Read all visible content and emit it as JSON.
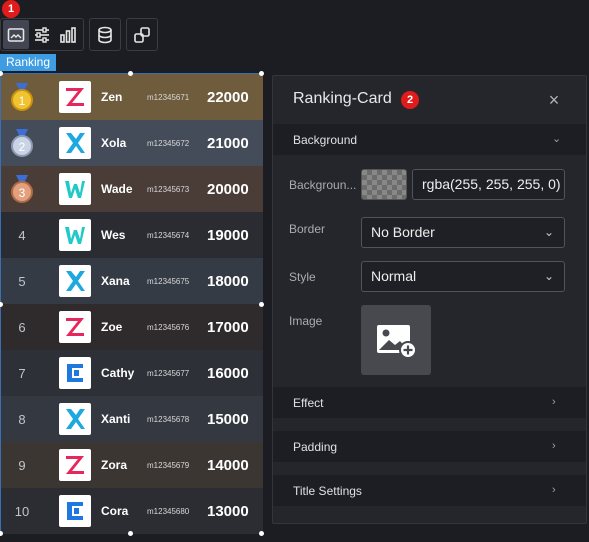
{
  "toolbar": {
    "badge": "1",
    "buttons": [
      {
        "icon": "image-icon",
        "active": true
      },
      {
        "icon": "sliders-icon",
        "active": false
      },
      {
        "icon": "bar-chart-icon",
        "active": false
      },
      {
        "icon": "database-icon",
        "active": false
      },
      {
        "icon": "interaction-icon",
        "active": false
      }
    ]
  },
  "component_tag": "Ranking",
  "ranking": [
    {
      "rank": "1",
      "name": "Zen",
      "id": "m12345671",
      "score": "22000",
      "logo": "Z",
      "color": "#e8265e",
      "bg": "#6e5c3d",
      "medal": "gold"
    },
    {
      "rank": "2",
      "name": "Xola",
      "id": "m12345672",
      "score": "21000",
      "logo": "X",
      "color": "#1da8e0",
      "bg": "#444c5a",
      "medal": "silver"
    },
    {
      "rank": "3",
      "name": "Wade",
      "id": "m12345673",
      "score": "20000",
      "logo": "W",
      "color": "#23c9c9",
      "bg": "#4a3d37",
      "medal": "bronze"
    },
    {
      "rank": "4",
      "name": "Wes",
      "id": "m12345674",
      "score": "19000",
      "logo": "W",
      "color": "#23c9c9",
      "bg": "#2b2c31"
    },
    {
      "rank": "5",
      "name": "Xana",
      "id": "m12345675",
      "score": "18000",
      "logo": "X",
      "color": "#1da8e0",
      "bg": "#353b45"
    },
    {
      "rank": "6",
      "name": "Zoe",
      "id": "m12345676",
      "score": "17000",
      "logo": "Z",
      "color": "#e8265e",
      "bg": "#2f2b2c"
    },
    {
      "rank": "7",
      "name": "Cathy",
      "id": "m12345677",
      "score": "16000",
      "logo": "C",
      "color": "#1e78e0",
      "bg": "#2d3037"
    },
    {
      "rank": "8",
      "name": "Xanti",
      "id": "m12345678",
      "score": "15000",
      "logo": "X",
      "color": "#1da8e0",
      "bg": "#333841"
    },
    {
      "rank": "9",
      "name": "Zora",
      "id": "m12345679",
      "score": "14000",
      "logo": "Z",
      "color": "#e8265e",
      "bg": "#3c3633"
    },
    {
      "rank": "10",
      "name": "Cora",
      "id": "m12345680",
      "score": "13000",
      "logo": "C",
      "color": "#1e78e0",
      "bg": "#2c2d32"
    }
  ],
  "panel": {
    "title": "Ranking-Card",
    "badge": "2",
    "close": "×",
    "background_section": "Background",
    "background_label": "Backgroun...",
    "background_value": "rgba(255, 255, 255, 0)",
    "border_label": "Border",
    "border_value": "No Border",
    "style_label": "Style",
    "style_value": "Normal",
    "image_label": "Image",
    "sections": [
      "Effect",
      "Padding",
      "Title Settings"
    ]
  }
}
